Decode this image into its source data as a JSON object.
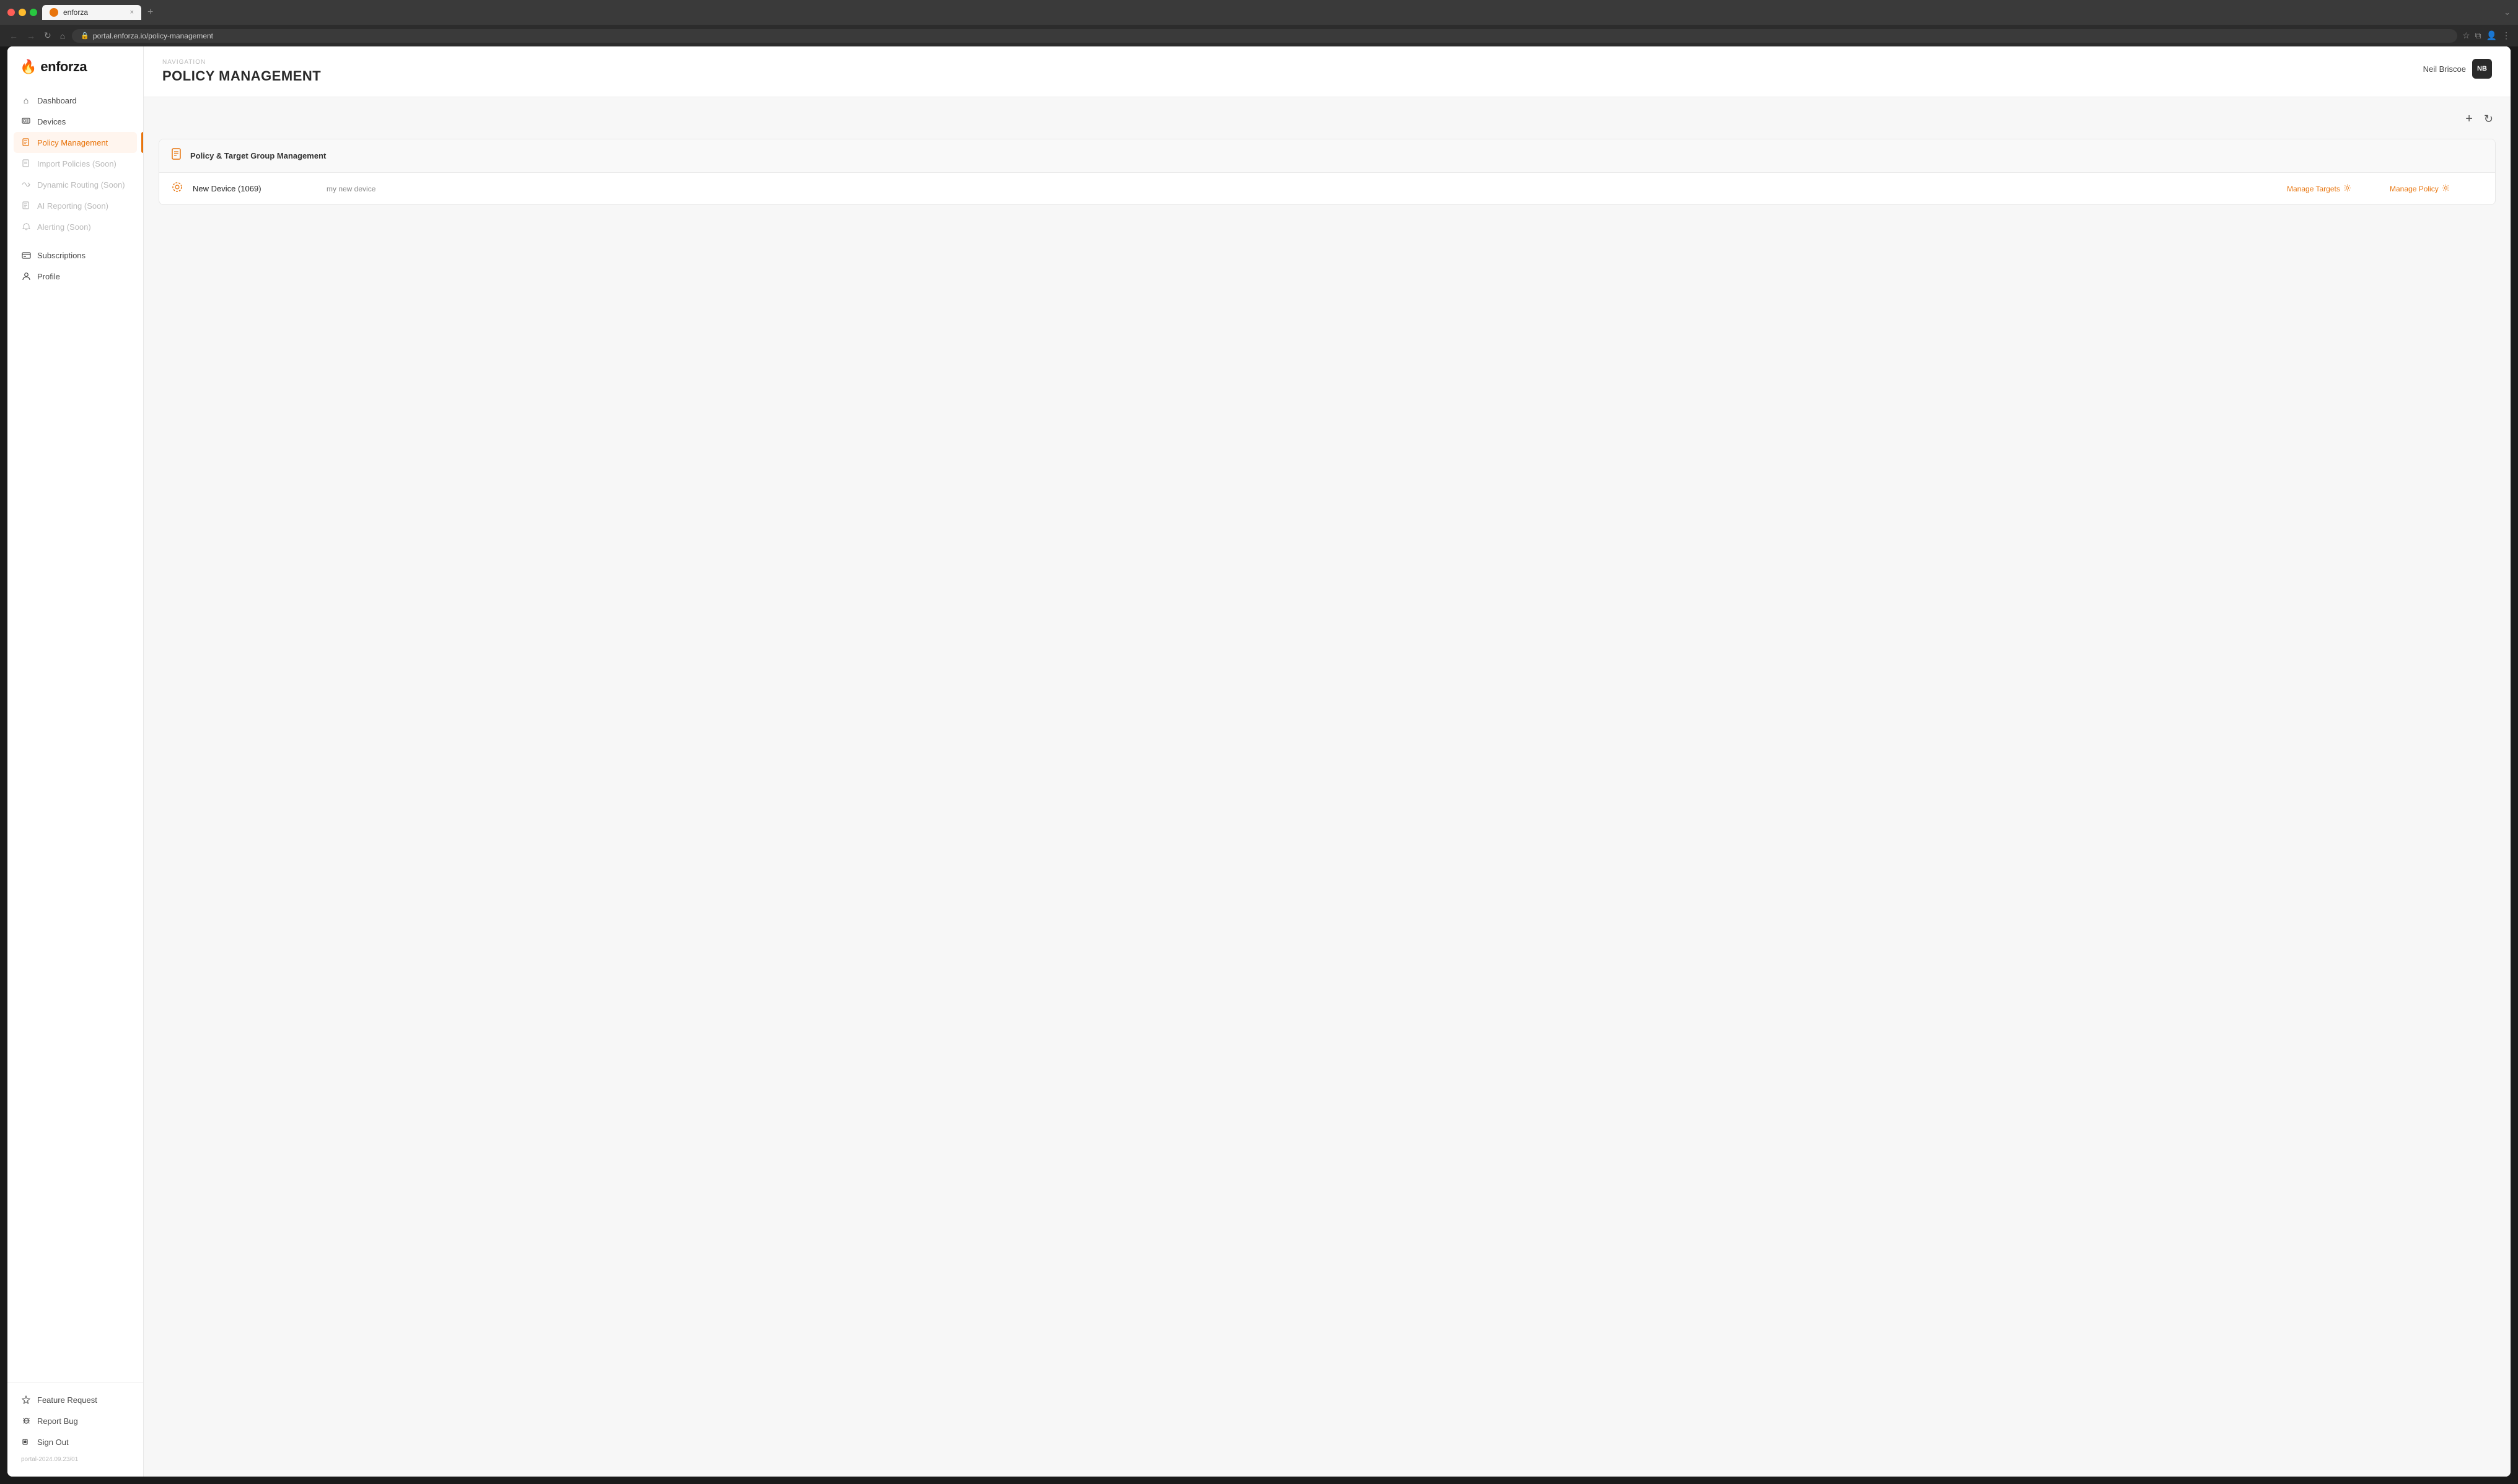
{
  "browser": {
    "tab_title": "enforza",
    "address": "portal.enforza.io/policy-management",
    "tab_close": "×",
    "tab_new": "+"
  },
  "header": {
    "breadcrumb": "NAVIGATION",
    "title": "POLICY MANAGEMENT",
    "user_name": "Neil Briscoe",
    "user_initials": "NB"
  },
  "sidebar": {
    "logo_text": "enforza",
    "nav_items": [
      {
        "id": "dashboard",
        "label": "Dashboard",
        "icon": "⌂",
        "active": false,
        "disabled": false
      },
      {
        "id": "devices",
        "label": "Devices",
        "icon": "▤",
        "active": false,
        "disabled": false
      },
      {
        "id": "policy-management",
        "label": "Policy Management",
        "icon": "📄",
        "active": true,
        "disabled": false
      },
      {
        "id": "import-policies",
        "label": "Import Policies (Soon)",
        "icon": "📥",
        "active": false,
        "disabled": true
      },
      {
        "id": "dynamic-routing",
        "label": "Dynamic Routing (Soon)",
        "icon": "↔",
        "active": false,
        "disabled": true
      },
      {
        "id": "ai-reporting",
        "label": "AI Reporting (Soon)",
        "icon": "📄",
        "active": false,
        "disabled": true
      },
      {
        "id": "alerting",
        "label": "Alerting (Soon)",
        "icon": "🔔",
        "active": false,
        "disabled": true
      },
      {
        "id": "subscriptions",
        "label": "Subscriptions",
        "icon": "💳",
        "active": false,
        "disabled": false
      },
      {
        "id": "profile",
        "label": "Profile",
        "icon": "👤",
        "active": false,
        "disabled": false
      }
    ],
    "bottom_items": [
      {
        "id": "feature-request",
        "label": "Feature Request",
        "icon": "✦",
        "active": false,
        "disabled": false
      },
      {
        "id": "report-bug",
        "label": "Report Bug",
        "icon": "🐞",
        "active": false,
        "disabled": false
      },
      {
        "id": "sign-out",
        "label": "Sign Out",
        "icon": "🔒",
        "active": false,
        "disabled": false
      }
    ],
    "version": "portal-2024.09.23/01"
  },
  "toolbar": {
    "add_icon": "+",
    "refresh_icon": "↻"
  },
  "policy_group": {
    "title": "Policy & Target Group Management",
    "rows": [
      {
        "device_name": "New Device (1069)",
        "device_description": "my new device",
        "manage_targets_label": "Manage Targets",
        "manage_policy_label": "Manage Policy"
      }
    ]
  }
}
